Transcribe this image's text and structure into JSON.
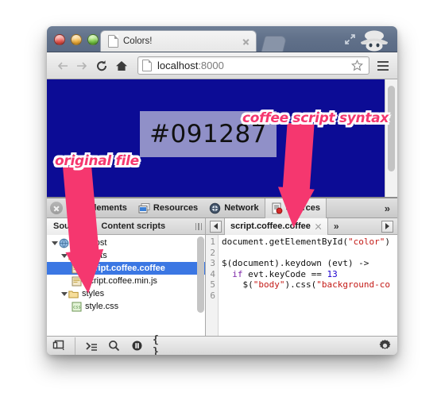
{
  "window": {
    "traffic_lights": [
      "close",
      "minimize",
      "zoom"
    ],
    "tab": {
      "title": "Colors!",
      "favicon": "document-icon",
      "close": "close-icon"
    },
    "new_tab": "new-tab-button",
    "fullscreen": "fullscreen-icon",
    "profile": "incognito-icon"
  },
  "navbar": {
    "back": "back-arrow-icon",
    "forward": "forward-arrow-icon",
    "reload": "reload-icon",
    "home": "home-icon",
    "url_host": "localhost",
    "url_port": ":8000",
    "bookmark": "star-icon",
    "menu": "hamburger-menu-icon"
  },
  "page": {
    "background_color": "#0c0c95",
    "input_value": "#091287",
    "input_background": "#9090c8",
    "scrollbar": "vertical-scrollbar"
  },
  "devtools": {
    "close": "close-icon",
    "tabs": [
      {
        "label": "Elements",
        "icon": "elements-icon",
        "active": false
      },
      {
        "label": "Resources",
        "icon": "resources-icon",
        "active": false
      },
      {
        "label": "Network",
        "icon": "network-icon",
        "active": false
      },
      {
        "label": "Sources",
        "icon": "sources-icon",
        "active": true
      }
    ],
    "overflow": "»",
    "navigator": {
      "tabs": [
        {
          "label": "Sources",
          "active": true
        },
        {
          "label": "Content scripts",
          "active": false
        }
      ],
      "tree": [
        {
          "label": "localhost",
          "type": "domain",
          "depth": 0,
          "expanded": true,
          "selected": false
        },
        {
          "label": "scripts",
          "type": "folder",
          "depth": 1,
          "expanded": true,
          "selected": false
        },
        {
          "label": "script.coffee.coffee",
          "type": "script",
          "depth": 2,
          "expanded": false,
          "selected": true
        },
        {
          "label": "script.coffee.min.js",
          "type": "script",
          "depth": 2,
          "expanded": false,
          "selected": false
        },
        {
          "label": "styles",
          "type": "folder",
          "depth": 1,
          "expanded": true,
          "selected": false
        },
        {
          "label": "style.css",
          "type": "stylesheet",
          "depth": 2,
          "expanded": false,
          "selected": false
        }
      ]
    },
    "editor": {
      "tab_label": "script.coffee.coffee",
      "tab_close": "close-icon",
      "more": "»",
      "prev": "prev-file-icon",
      "next": "next-file-icon",
      "line_numbers": [
        "1",
        "2",
        "3",
        "4",
        "5",
        "6"
      ],
      "lines": [
        "document.getElementById(\"color\")",
        "",
        "$(document).keydown (evt) ->",
        "  if evt.keyCode == 13",
        "    $(\"body\").css(\"background-co",
        ""
      ]
    },
    "statusbar": {
      "dock": "dock-panel-icon",
      "console": "console-icon",
      "search": "search-icon",
      "pause": "pause-on-exceptions-icon",
      "format": "{ }",
      "settings": "gear-icon"
    }
  },
  "annotations": [
    {
      "text": "original file",
      "color": "#f5376f"
    },
    {
      "text": "coffee script syntax",
      "color": "#f5376f"
    }
  ]
}
